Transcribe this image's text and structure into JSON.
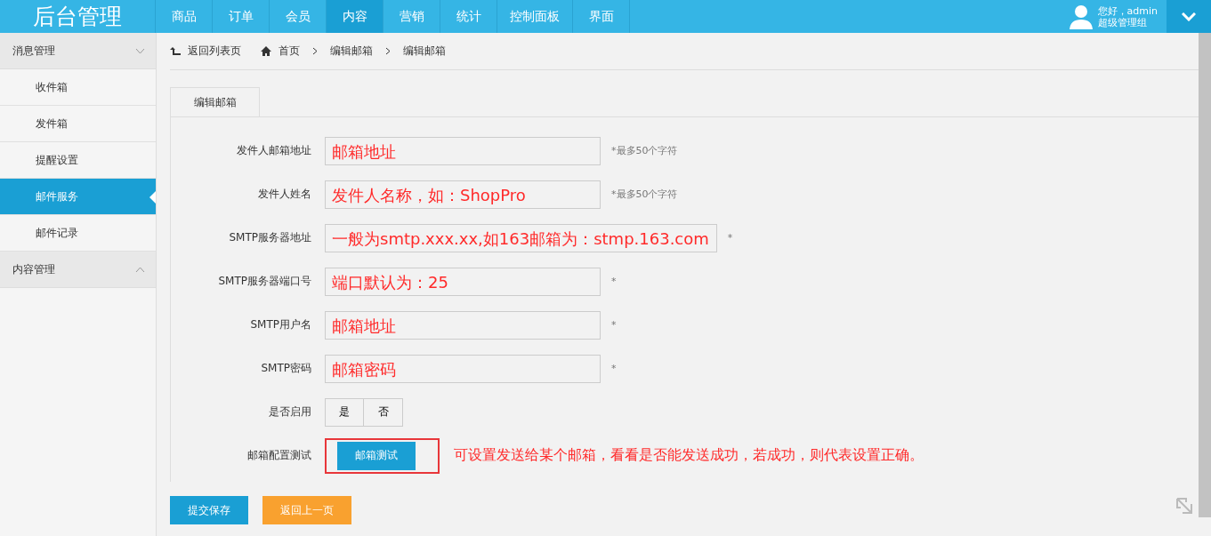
{
  "header": {
    "logo": "后台管理",
    "nav": [
      {
        "label": "商品",
        "selected": false
      },
      {
        "label": "订单",
        "selected": false
      },
      {
        "label": "会员",
        "selected": false
      },
      {
        "label": "内容",
        "selected": true
      },
      {
        "label": "营销",
        "selected": false
      },
      {
        "label": "统计",
        "selected": false
      },
      {
        "label": "控制面板",
        "selected": false
      },
      {
        "label": "界面",
        "selected": false
      }
    ],
    "user": {
      "greeting": "您好，admin",
      "role": "超级管理组"
    }
  },
  "sidebar": [
    {
      "label": "消息管理",
      "expanded": true,
      "children": [
        {
          "label": "收件箱",
          "selected": false
        },
        {
          "label": "发件箱",
          "selected": false
        },
        {
          "label": "提醒设置",
          "selected": false
        },
        {
          "label": "邮件服务",
          "selected": true
        },
        {
          "label": "邮件记录",
          "selected": false
        }
      ]
    },
    {
      "label": "内容管理",
      "expanded": false
    }
  ],
  "breadcrumb": {
    "back": "返回列表页",
    "items": [
      "首页",
      "编辑邮箱",
      "编辑邮箱"
    ]
  },
  "tab": "编辑邮箱",
  "form": {
    "fields": [
      {
        "label": "发件人邮箱地址",
        "annotation": "邮箱地址",
        "hint": "*最多50个字符"
      },
      {
        "label": "发件人姓名",
        "annotation": "发件人名称，如：ShopPro",
        "hint": "*最多50个字符"
      },
      {
        "label": "SMTP服务器地址",
        "annotation": "一般为smtp.xxx.xx,如163邮箱为：stmp.163.com",
        "hint": "*"
      },
      {
        "label": "SMTP服务器端口号",
        "annotation": "端口默认为：25",
        "hint": "*"
      },
      {
        "label": "SMTP用户名",
        "annotation": "邮箱地址",
        "hint": "*"
      },
      {
        "label": "SMTP密码",
        "annotation": "邮箱密码",
        "hint": "*"
      }
    ],
    "enable": {
      "label": "是否启用",
      "options": [
        "是",
        "否"
      ]
    },
    "test": {
      "label": "邮箱配置测试",
      "button": "邮箱测试",
      "note": "可设置发送给某个邮箱，看看是否能发送成功，若成功，则代表设置正确。"
    }
  },
  "actions": {
    "save": "提交保存",
    "back": "返回上一页"
  }
}
